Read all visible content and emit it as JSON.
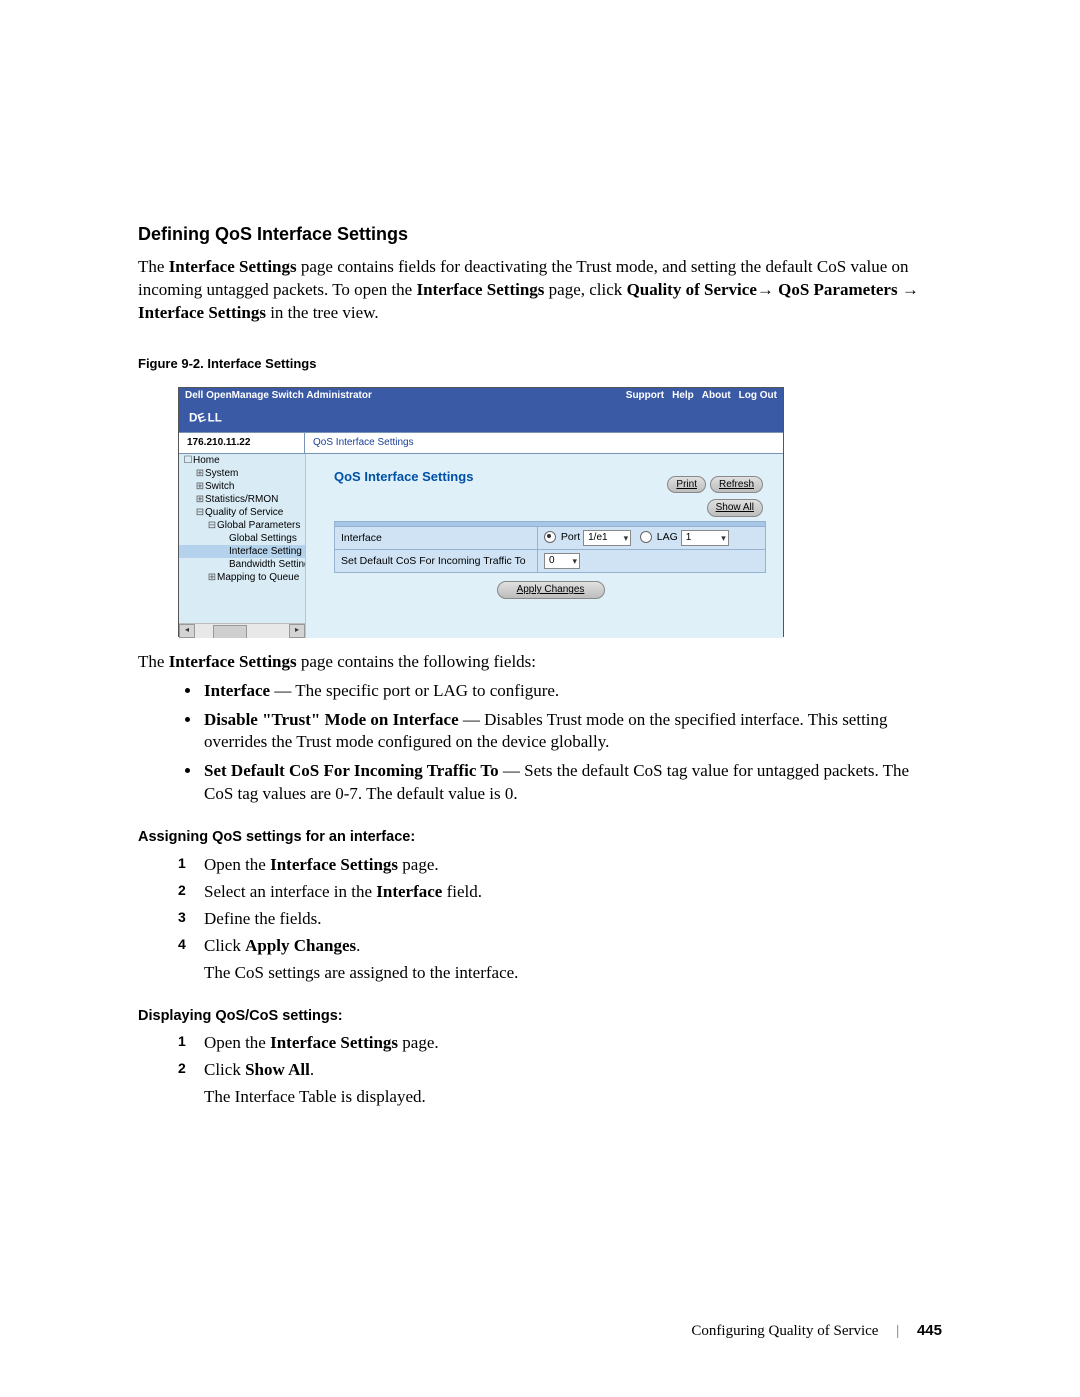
{
  "section_heading": "Defining QoS Interface Settings",
  "intro": {
    "line1_prefix": "The ",
    "line1_bold": "Interface Settings",
    "line1_suffix": " page contains fields for deactivating the Trust mode, and setting the default CoS value on incoming untagged packets. To open the ",
    "line1_bold2": "Interface Settings",
    "line1_suffix2": " page, click ",
    "line1_bold3": "Quality of Service",
    "arrow": "→ ",
    "line2_bold1": "QoS Parameters",
    "line2_mid": " → ",
    "line2_bold2": "Interface Settings",
    "line2_suffix": " in the tree view."
  },
  "figure_caption": "Figure 9-2.    Interface Settings",
  "screenshot": {
    "topbar_title": "Dell OpenManage Switch Administrator",
    "top_links": [
      "Support",
      "Help",
      "About",
      "Log Out"
    ],
    "ip": "176.210.11.22",
    "breadcrumb": "QoS Interface Settings",
    "page_title": "QoS Interface Settings",
    "buttons": {
      "print": "Print",
      "refresh": "Refresh",
      "showall": "Show All",
      "apply": "Apply Changes"
    },
    "tree": [
      {
        "indent": 0,
        "glyph": "☐",
        "label": "Home"
      },
      {
        "indent": 1,
        "glyph": "⊞",
        "label": "System"
      },
      {
        "indent": 1,
        "glyph": "⊞",
        "label": "Switch"
      },
      {
        "indent": 1,
        "glyph": "⊞",
        "label": "Statistics/RMON"
      },
      {
        "indent": 1,
        "glyph": "⊟",
        "label": "Quality of Service"
      },
      {
        "indent": 2,
        "glyph": "⊟",
        "label": "Global Parameters"
      },
      {
        "indent": 3,
        "glyph": "",
        "label": "Global Settings"
      },
      {
        "indent": 3,
        "glyph": "",
        "label": "Interface Setting",
        "hl": true
      },
      {
        "indent": 3,
        "glyph": "",
        "label": "Bandwidth Setting"
      },
      {
        "indent": 2,
        "glyph": "⊞",
        "label": "Mapping to Queue"
      }
    ],
    "form": {
      "row1_label": "Interface",
      "row1_port_label": "Port",
      "row1_port_value": "1/e1",
      "row1_lag_label": "LAG",
      "row1_lag_value": "1",
      "row2_label": "Set Default CoS For Incoming Traffic To",
      "row2_value": "0"
    }
  },
  "after_fig": {
    "intro_prefix": "The ",
    "intro_bold": "Interface Settings",
    "intro_suffix": " page contains the following fields:",
    "bullets": [
      {
        "bold": "Interface",
        "text": " — The specific port or LAG to configure."
      },
      {
        "bold": "Disable \"Trust\" Mode on Interface",
        "text": " — Disables Trust mode on the specified interface. This setting overrides the Trust mode configured on the device globally."
      },
      {
        "bold": "Set Default CoS For Incoming Traffic To",
        "text": " — Sets the default CoS tag value for untagged packets. The CoS tag values are 0-7. The default value is 0."
      }
    ]
  },
  "assign": {
    "heading": "Assigning QoS settings for an interface:",
    "steps": [
      {
        "n": "1",
        "prefix": "Open the ",
        "bold": "Interface Settings",
        "suffix": " page."
      },
      {
        "n": "2",
        "prefix": "Select an interface in the ",
        "bold": "Interface",
        "suffix": " field."
      },
      {
        "n": "3",
        "prefix": "Define the fields.",
        "bold": "",
        "suffix": ""
      },
      {
        "n": "4",
        "prefix": "Click ",
        "bold": "Apply Changes",
        "suffix": "."
      }
    ],
    "result": "The CoS settings are assigned to the interface."
  },
  "display": {
    "heading": "Displaying QoS/CoS settings:",
    "steps": [
      {
        "n": "1",
        "prefix": "Open the ",
        "bold": "Interface Settings",
        "suffix": " page."
      },
      {
        "n": "2",
        "prefix": "Click ",
        "bold": "Show All",
        "suffix": "."
      }
    ],
    "result": "The Interface Table is displayed."
  },
  "footer": {
    "chapter": "Configuring Quality of Service",
    "page": "445"
  }
}
